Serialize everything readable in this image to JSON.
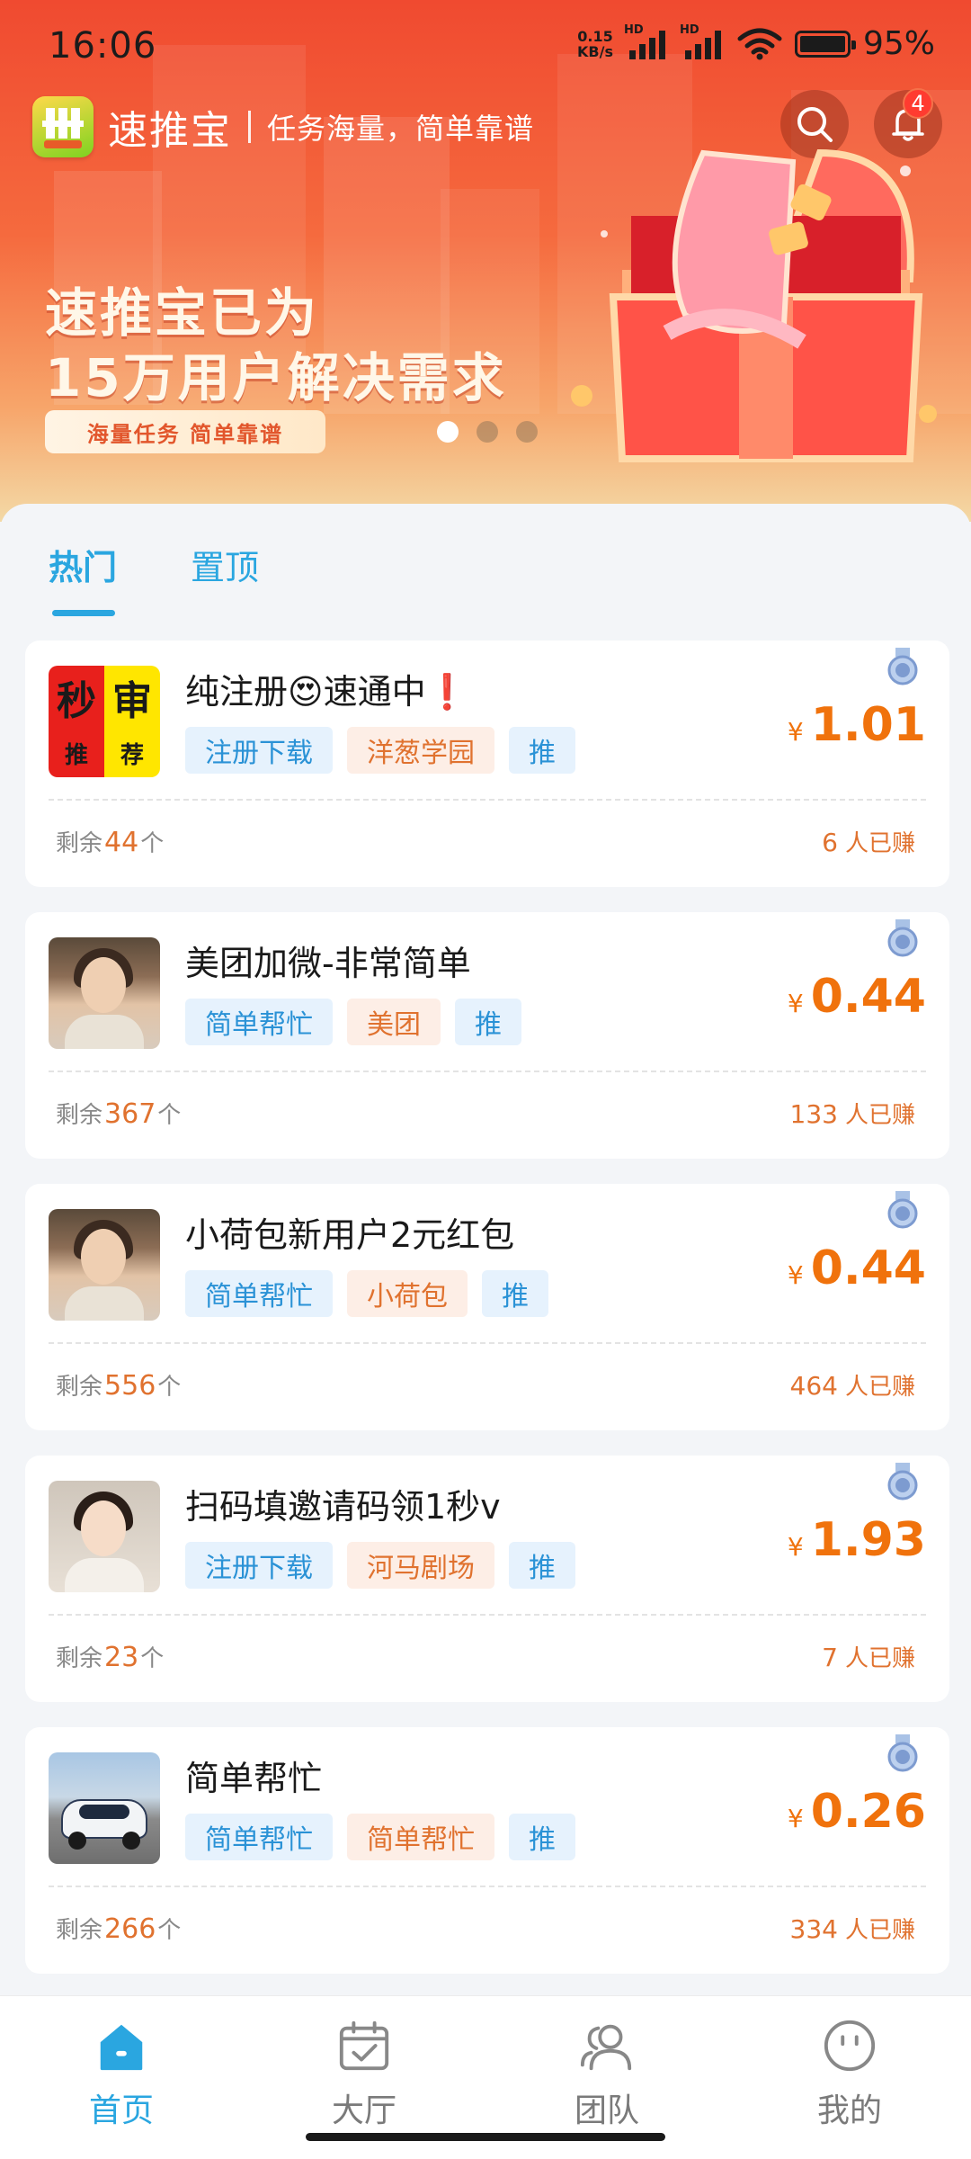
{
  "status_bar": {
    "time": "16:06",
    "net_speed_value": "0.15",
    "net_speed_unit": "KB/s",
    "hd_label": "HD",
    "battery": "95%"
  },
  "header": {
    "app_name": "速推宝",
    "slogan": "任务海量，简单靠谱",
    "logo_text": "速推宝",
    "notification_count": "4"
  },
  "banner": {
    "headline_line1": "速推宝已为",
    "headline_line2": "15万用户解决需求",
    "pill_text": "海量任务  简单靠谱",
    "slide_count": 3,
    "active_slide": 0
  },
  "tabs": [
    {
      "label": "热门",
      "active": true
    },
    {
      "label": "置顶",
      "active": false
    }
  ],
  "labels": {
    "remaining_prefix": "剩余",
    "remaining_unit": "个",
    "earned_suffix": "人已赚",
    "currency": "¥"
  },
  "tasks": [
    {
      "title": "纯注册😍速通中❗",
      "thumb": "miao-shen",
      "thumb_text": [
        "秒",
        "审",
        "推",
        "荐"
      ],
      "tags": [
        "注册下载",
        "洋葱学园",
        "推"
      ],
      "price": "1.01",
      "remaining": "44",
      "earned": "6"
    },
    {
      "title": "美团加微-非常简单",
      "thumb": "woman-photo",
      "tags": [
        "简单帮忙",
        "美团",
        "推"
      ],
      "price": "0.44",
      "remaining": "367",
      "earned": "133"
    },
    {
      "title": "小荷包新用户2元红包",
      "thumb": "woman-photo",
      "tags": [
        "简单帮忙",
        "小荷包",
        "推"
      ],
      "price": "0.44",
      "remaining": "556",
      "earned": "464"
    },
    {
      "title": "扫码填邀请码领1秒v",
      "thumb": "girl-photo",
      "tags": [
        "注册下载",
        "河马剧场",
        "推"
      ],
      "price": "1.93",
      "remaining": "23",
      "earned": "7"
    },
    {
      "title": "简单帮忙",
      "thumb": "car-photo",
      "tags": [
        "简单帮忙",
        "简单帮忙",
        "推"
      ],
      "price": "0.26",
      "remaining": "266",
      "earned": "334"
    }
  ],
  "bottom_nav": [
    {
      "label": "首页",
      "icon": "home-icon",
      "active": true
    },
    {
      "label": "大厅",
      "icon": "calendar-check-icon",
      "active": false
    },
    {
      "label": "团队",
      "icon": "team-icon",
      "active": false
    },
    {
      "label": "我的",
      "icon": "smiley-icon",
      "active": false
    }
  ],
  "colors": {
    "accent": "#2aa6e0",
    "price": "#f0720c",
    "banner_top": "#f04a30"
  }
}
